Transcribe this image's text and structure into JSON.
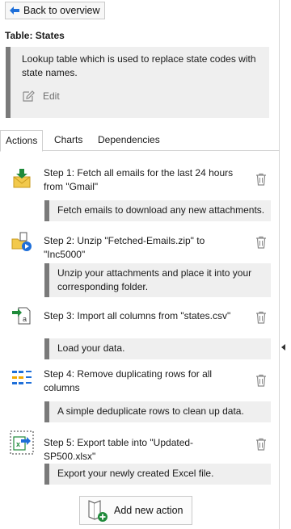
{
  "header": {
    "back_label": "Back to overview",
    "table_title": "Table: States"
  },
  "description": {
    "text": "Lookup table which is used to replace state codes with state names.",
    "edit_label": "Edit"
  },
  "tabs": [
    {
      "label": "Actions",
      "active": true
    },
    {
      "label": "Charts",
      "active": false
    },
    {
      "label": "Dependencies",
      "active": false
    }
  ],
  "steps": [
    {
      "icon": "fetch-email-icon",
      "title": "Step 1: Fetch all emails for the last 24 hours from \"Gmail\"",
      "note": "Fetch emails to download any new attachments."
    },
    {
      "icon": "unzip-folder-icon",
      "title": "Step 2: Unzip \"Fetched-Emails.zip\" to \"Inc5000\"",
      "note": "Unzip your attachments and place it into your corresponding folder."
    },
    {
      "icon": "import-csv-icon",
      "title": "Step 3: Import all columns from \"states.csv\"",
      "note": "Load your data."
    },
    {
      "icon": "dedupe-rows-icon",
      "title": "Step 4: Remove duplicating rows for all columns",
      "note": "A simple deduplicate rows to clean up data."
    },
    {
      "icon": "export-excel-icon",
      "title": "Step 5: Export table into \"Updated-SP500.xlsx\"",
      "note": "Export your newly created Excel file."
    }
  ],
  "add_action_label": "Add new action",
  "colors": {
    "note_bar": "#7a7a7a",
    "note_bg": "#efefef",
    "accent_blue": "#1e6fd9",
    "accent_green": "#1f8a3a"
  }
}
